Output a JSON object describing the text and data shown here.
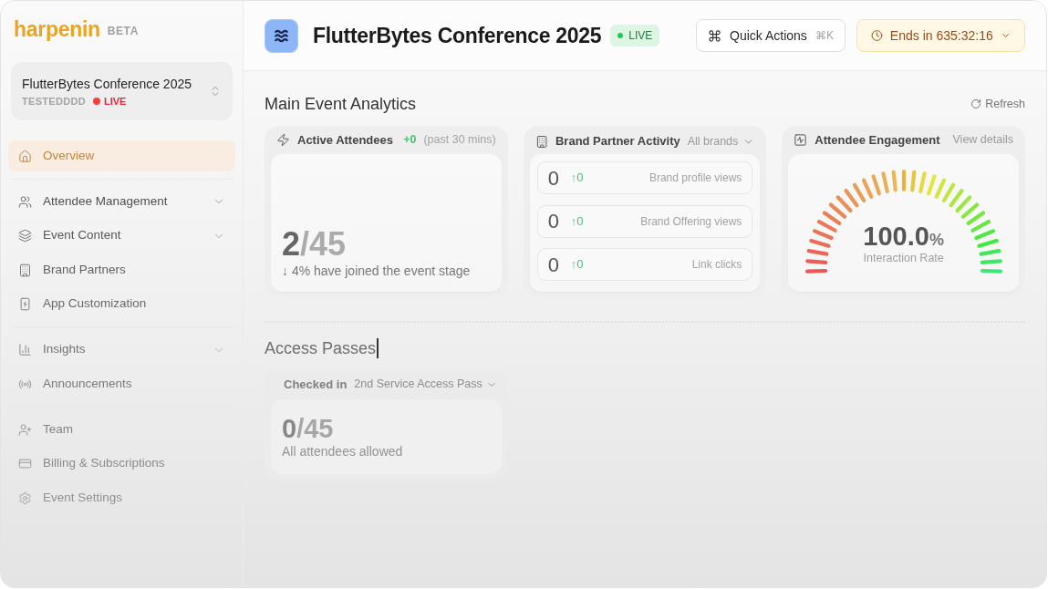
{
  "sidebar": {
    "logo": {
      "wordmark": "harpenin",
      "badge": "BETA"
    },
    "event_switcher": {
      "name": "FlutterBytes Conference 2025",
      "code": "TESTEDDDD",
      "status": "LIVE"
    },
    "nav_groups": [
      {
        "items": [
          {
            "label": "Overview",
            "selected": true,
            "expandable": false
          }
        ]
      },
      {
        "items": [
          {
            "label": "Attendee Management",
            "selected": false,
            "expandable": true
          },
          {
            "label": "Event Content",
            "selected": false,
            "expandable": true
          },
          {
            "label": "Brand Partners",
            "selected": false,
            "expandable": false
          },
          {
            "label": "App Customization",
            "selected": false,
            "expandable": false
          }
        ]
      },
      {
        "items": [
          {
            "label": "Insights",
            "selected": false,
            "expandable": true
          },
          {
            "label": "Announcements",
            "selected": false,
            "expandable": false
          }
        ]
      },
      {
        "items": [
          {
            "label": "Team",
            "selected": false,
            "expandable": false
          },
          {
            "label": "Billing & Subscriptions",
            "selected": false,
            "expandable": false
          },
          {
            "label": "Event Settings",
            "selected": false,
            "expandable": false
          }
        ]
      }
    ]
  },
  "header": {
    "title": "FlutterBytes Conference 2025",
    "status": "LIVE",
    "quick_actions": {
      "label": "Quick Actions",
      "shortcut": "⌘K"
    },
    "timer": {
      "label": "Ends in 635:32:16"
    }
  },
  "main": {
    "title": "Main Event Analytics",
    "refresh": "Refresh",
    "cards": [
      {
        "kind": "attendees",
        "title": "Active Attendees",
        "change": "+0",
        "period": "(past 30 mins)",
        "count": "2",
        "total": "/45",
        "note": "↓ 4% have joined the event stage"
      },
      {
        "kind": "brand_activity",
        "title": "Brand Partner Activity",
        "filter": "All brands",
        "rows": [
          {
            "value": "0",
            "change": "↑0",
            "label": "Brand profile views"
          },
          {
            "value": "0",
            "change": "↑0",
            "label": "Brand Offering views"
          },
          {
            "value": "0",
            "change": "↑0",
            "label": "Link clicks"
          }
        ]
      },
      {
        "kind": "engagement",
        "title": "Attendee Engagement",
        "link": "View details",
        "value": "100.0",
        "unit": "%",
        "caption": "Interaction Rate"
      }
    ]
  },
  "access_passes": {
    "title": "Access Passes",
    "cards": [
      {
        "title": "Checked in",
        "filter": "2nd Service Access Pass",
        "count": "0",
        "total": "/45",
        "caption": "All attendees allowed"
      }
    ]
  }
}
